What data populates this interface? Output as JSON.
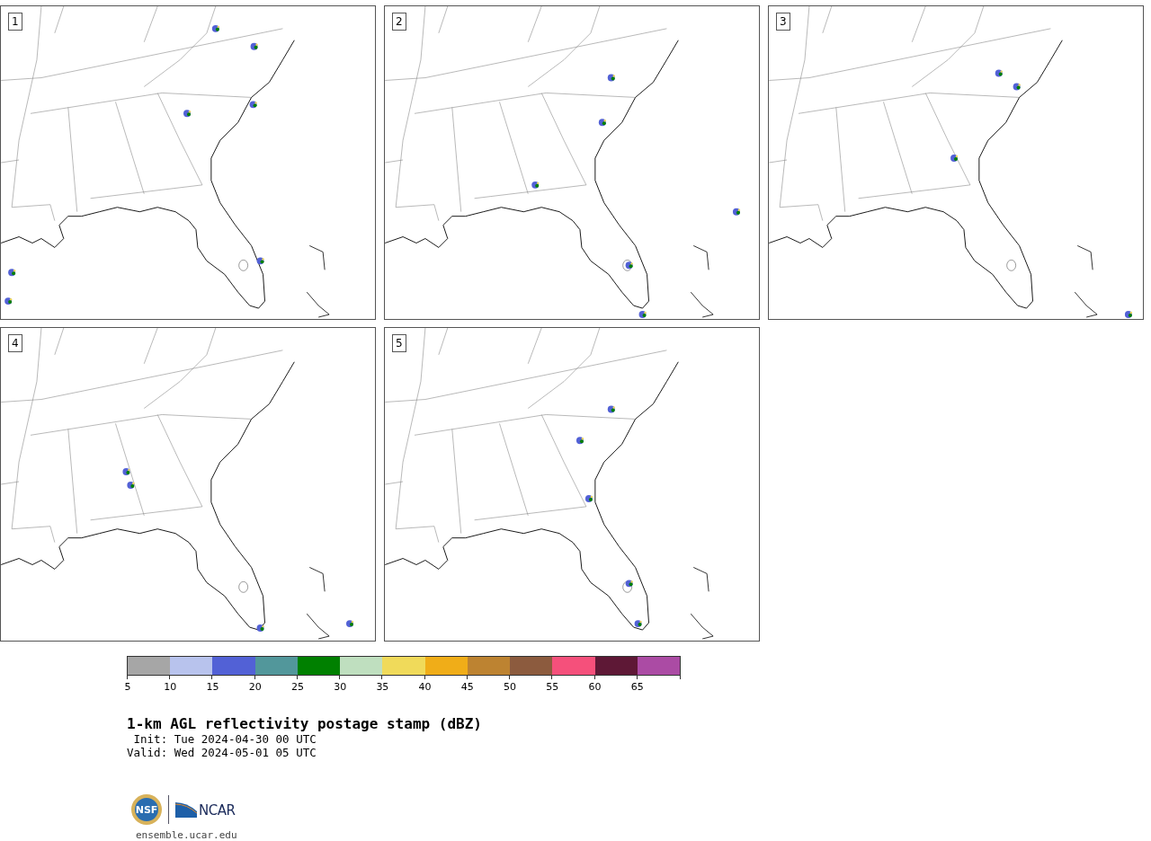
{
  "panels": [
    {
      "label": "1"
    },
    {
      "label": "2"
    },
    {
      "label": "3"
    },
    {
      "label": "4"
    },
    {
      "label": "5"
    }
  ],
  "colorbar": {
    "bins": [
      {
        "color": "#a6a6a6"
      },
      {
        "color": "#b8c3ed"
      },
      {
        "color": "#5261d6"
      },
      {
        "color": "#52979b"
      },
      {
        "color": "#008000"
      },
      {
        "color": "#bfdfbf"
      },
      {
        "color": "#f0da5a"
      },
      {
        "color": "#f0ad18"
      },
      {
        "color": "#bd8331"
      },
      {
        "color": "#8c5b3e"
      },
      {
        "color": "#f5507b"
      },
      {
        "color": "#5e1836"
      },
      {
        "color": "#ab4ba4"
      }
    ],
    "ticks": [
      "5",
      "10",
      "15",
      "20",
      "25",
      "30",
      "35",
      "40",
      "45",
      "50",
      "55",
      "60",
      "65"
    ]
  },
  "title": "1-km AGL reflectivity postage stamp (dBZ)",
  "init": " Init: Tue 2024-04-30 00 UTC",
  "valid": "Valid: Wed 2024-05-01 05 UTC",
  "logos": {
    "nsf": "NSF",
    "ncar": "NCAR"
  },
  "site": "ensemble.ucar.edu"
}
